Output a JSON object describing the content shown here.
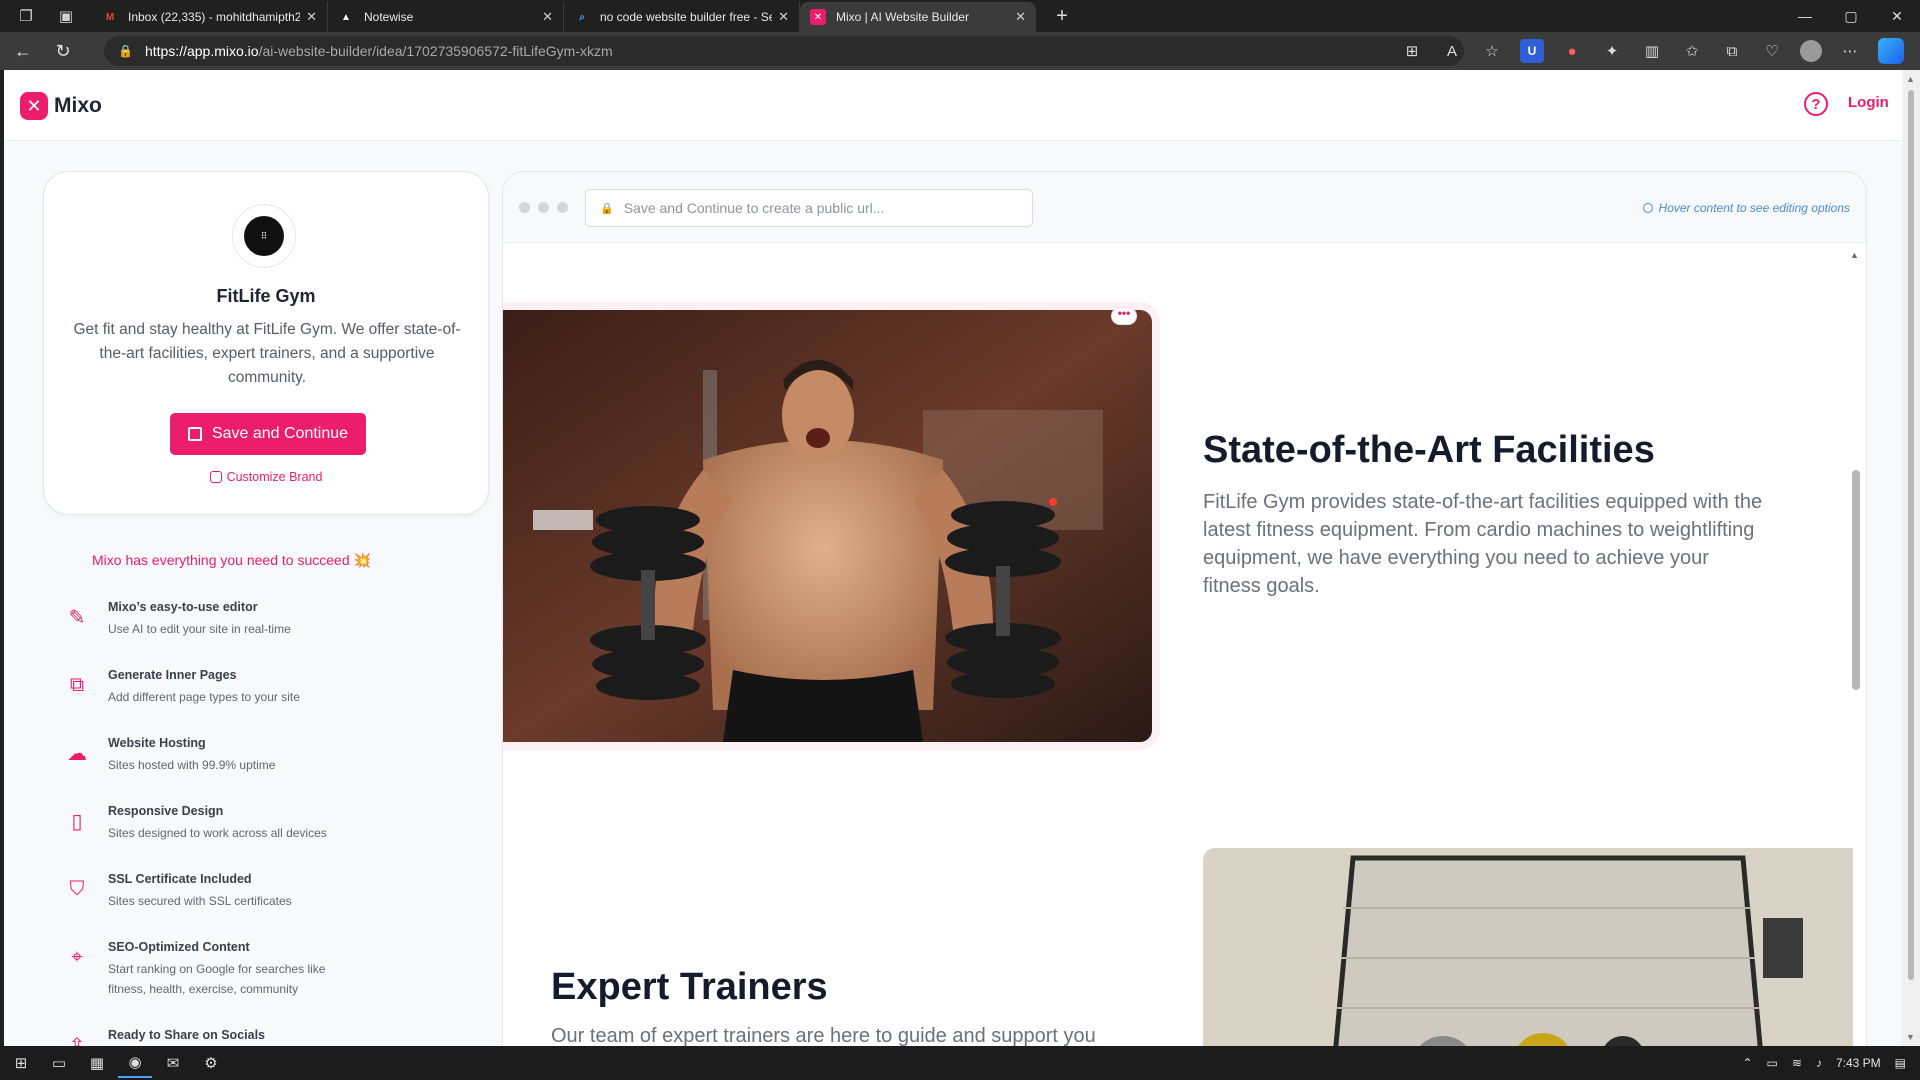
{
  "browser": {
    "tabs": [
      {
        "title": "Inbox (22,335) - mohitdhamipth2",
        "favicon": "M",
        "favicon_color": "#ea4335",
        "active": false
      },
      {
        "title": "Notewise",
        "favicon": "▲",
        "favicon_color": "#ffffff",
        "active": false
      },
      {
        "title": "no code website builder free - Se",
        "favicon": "⌕",
        "favicon_color": "#4aa3ff",
        "active": false
      },
      {
        "title": "Mixo | AI Website Builder",
        "favicon": "✕",
        "favicon_color": "#ec1e6b",
        "active": true
      }
    ],
    "new_tab": "+",
    "window_controls": {
      "minimize": "—",
      "maximize": "▢",
      "close": "✕"
    },
    "url_host": "https://app.mixo.io",
    "url_path": "/ai-website-builder/idea/1702735906572-fitLifeGym-xkzm"
  },
  "header": {
    "logo_mark": "✕",
    "logo_text": "Mixo",
    "help_icon": "?",
    "login": "Login"
  },
  "brand": {
    "avatar_text": "⠿",
    "name": "FitLife Gym",
    "description": "Get fit and stay healthy at FitLife Gym. We offer state-of-the-art facilities, expert trainers, and a supportive community.",
    "save_button": "Save and Continue",
    "customize": "Customize Brand"
  },
  "sidebar": {
    "succeed_text": "Mixo has everything you need to succeed",
    "succeed_emoji": "💥",
    "features": [
      {
        "title": "Mixo’s easy-to-use editor",
        "desc": "Use AI to edit your site in real-time",
        "icon": "✎"
      },
      {
        "title": "Generate Inner Pages",
        "desc": "Add different page types to your site",
        "icon": "⧉"
      },
      {
        "title": "Website Hosting",
        "desc": "Sites hosted with 99.9% uptime",
        "icon": "☁"
      },
      {
        "title": "Responsive Design",
        "desc": "Sites designed to work across all devices",
        "icon": "▯"
      },
      {
        "title": "SSL Certificate Included",
        "desc": "Sites secured with SSL certificates",
        "icon": "⛉"
      },
      {
        "title": "SEO-Optimized Content",
        "desc": "Start ranking on Google for searches like fitness, health, exercise, community",
        "icon": "⌖"
      },
      {
        "title": "Ready to Share on Socials",
        "desc": "",
        "icon": "⇪"
      }
    ]
  },
  "preview": {
    "url_placeholder": "Save and Continue to create a public url...",
    "hover_hint": "Hover content to see editing options",
    "image_menu": "•••",
    "section1": {
      "title": "State-of-the-Art Facilities",
      "body": "FitLife Gym provides state-of-the-art facilities equipped with the latest fitness equipment. From cardio machines to weightlifting equipment, we have everything you need to achieve your fitness goals."
    },
    "section2": {
      "title": "Expert Trainers",
      "body": "Our team of expert trainers are here to guide and support you"
    }
  },
  "taskbar": {
    "time": "7:43 PM"
  }
}
